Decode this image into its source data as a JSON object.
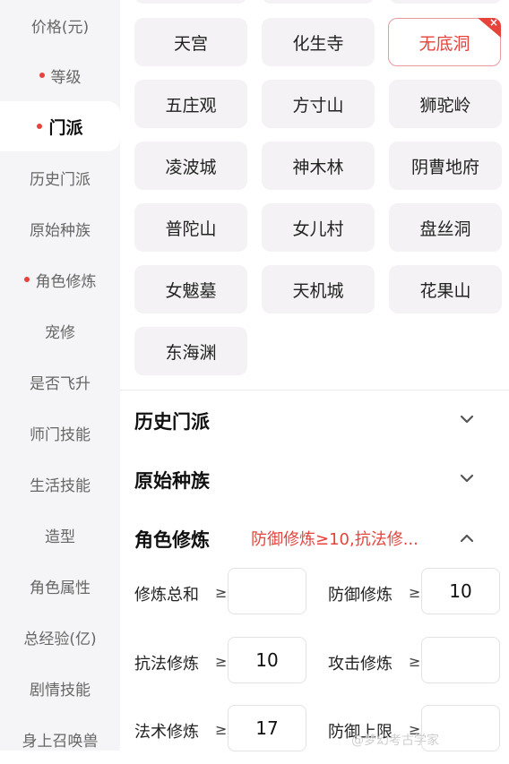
{
  "sidebar": {
    "items": [
      {
        "label": "价格(元)",
        "dot": false
      },
      {
        "label": "等级",
        "dot": true
      },
      {
        "label": "门派",
        "dot": true,
        "active": true
      },
      {
        "label": "历史门派",
        "dot": false
      },
      {
        "label": "原始种族",
        "dot": false
      },
      {
        "label": "角色修炼",
        "dot": true
      },
      {
        "label": "宠修",
        "dot": false
      },
      {
        "label": "是否飞升",
        "dot": false
      },
      {
        "label": "师门技能",
        "dot": false
      },
      {
        "label": "生活技能",
        "dot": false
      },
      {
        "label": "造型",
        "dot": false
      },
      {
        "label": "角色属性",
        "dot": false
      },
      {
        "label": "总经验(亿)",
        "dot": false
      },
      {
        "label": "剧情技能",
        "dot": false
      },
      {
        "label": "身上召唤兽",
        "dot": false
      }
    ]
  },
  "schools": {
    "items": [
      "天宫",
      "化生寺",
      "无底洞",
      "五庄观",
      "方寸山",
      "狮驼岭",
      "凌波城",
      "神木林",
      "阴曹地府",
      "普陀山",
      "女儿村",
      "盘丝洞",
      "女魃墓",
      "天机城",
      "花果山",
      "东海渊"
    ],
    "selected": "无底洞",
    "selected_mark": "×"
  },
  "sections": {
    "history": {
      "title": "历史门派"
    },
    "race": {
      "title": "原始种族"
    },
    "cultivation": {
      "title": "角色修炼",
      "summary": "防御修炼≥10,抗法修..."
    }
  },
  "cultivation_fields": [
    {
      "label": "修炼总和",
      "op": "≥",
      "value": ""
    },
    {
      "label": "防御修炼",
      "op": "≥",
      "value": "10"
    },
    {
      "label": "抗法修炼",
      "op": "≥",
      "value": "10"
    },
    {
      "label": "攻击修炼",
      "op": "≥",
      "value": ""
    },
    {
      "label": "法术修炼",
      "op": "≥",
      "value": "17"
    },
    {
      "label": "防御上限",
      "op": "≥",
      "value": ""
    }
  ],
  "watermark": "@梦幻考古学家",
  "colors": {
    "accent": "#e4443c",
    "tile_bg": "#f4f2f4",
    "sidebar_bg": "#f5f5f7"
  }
}
